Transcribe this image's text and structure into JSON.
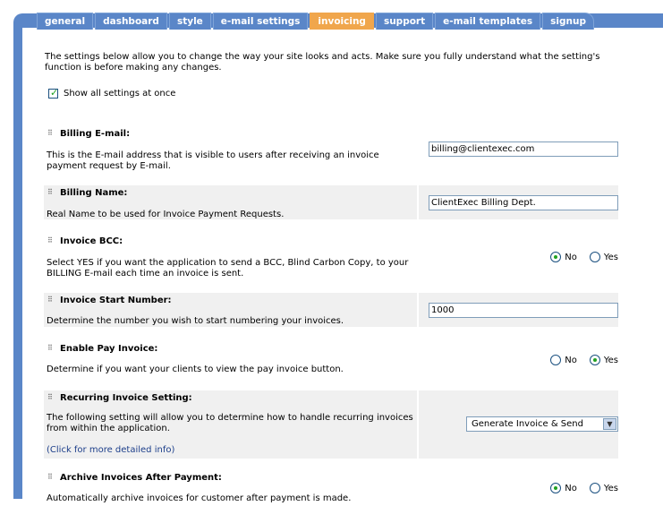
{
  "tabs": [
    "general",
    "dashboard",
    "style",
    "e-mail settings",
    "invoicing",
    "support",
    "e-mail templates",
    "signup"
  ],
  "active_tab": "invoicing",
  "intro": "The settings below allow you to change the way your site looks and acts. Make sure you fully understand what the setting's function is before making any changes.",
  "show_all_label": "Show all settings at once",
  "settings": {
    "billing_email": {
      "title": "Billing E-mail:",
      "desc": "This is the E-mail address that is visible to users after receiving an invoice payment request by E-mail.",
      "value": "billing@clientexec.com"
    },
    "billing_name": {
      "title": "Billing Name:",
      "desc": "Real Name to be used for Invoice Payment Requests.",
      "value": "ClientExec Billing Dept."
    },
    "invoice_bcc": {
      "title": "Invoice BCC:",
      "desc": "Select YES if you want the application to send a BCC, Blind Carbon Copy, to your BILLING E-mail each time an invoice is sent.",
      "no_label": "No",
      "yes_label": "Yes",
      "selected": "No"
    },
    "invoice_start": {
      "title": "Invoice Start Number:",
      "desc": "Determine the number you wish to start numbering your invoices.",
      "value": "1000"
    },
    "pay_invoice": {
      "title": "Enable Pay Invoice:",
      "desc": "Determine if you want your clients to view the pay invoice button.",
      "no_label": "No",
      "yes_label": "Yes",
      "selected": "Yes"
    },
    "recurring": {
      "title": "Recurring Invoice Setting:",
      "desc": "The following setting will allow you to determine how to handle recurring invoices from within the application.",
      "link": "(Click for more detailed info)",
      "value": "Generate Invoice & Send"
    },
    "archive": {
      "title": "Archive Invoices After Payment:",
      "desc": "Automatically archive invoices for customer after payment is made.",
      "no_label": "No",
      "yes_label": "Yes",
      "selected": "No"
    }
  }
}
